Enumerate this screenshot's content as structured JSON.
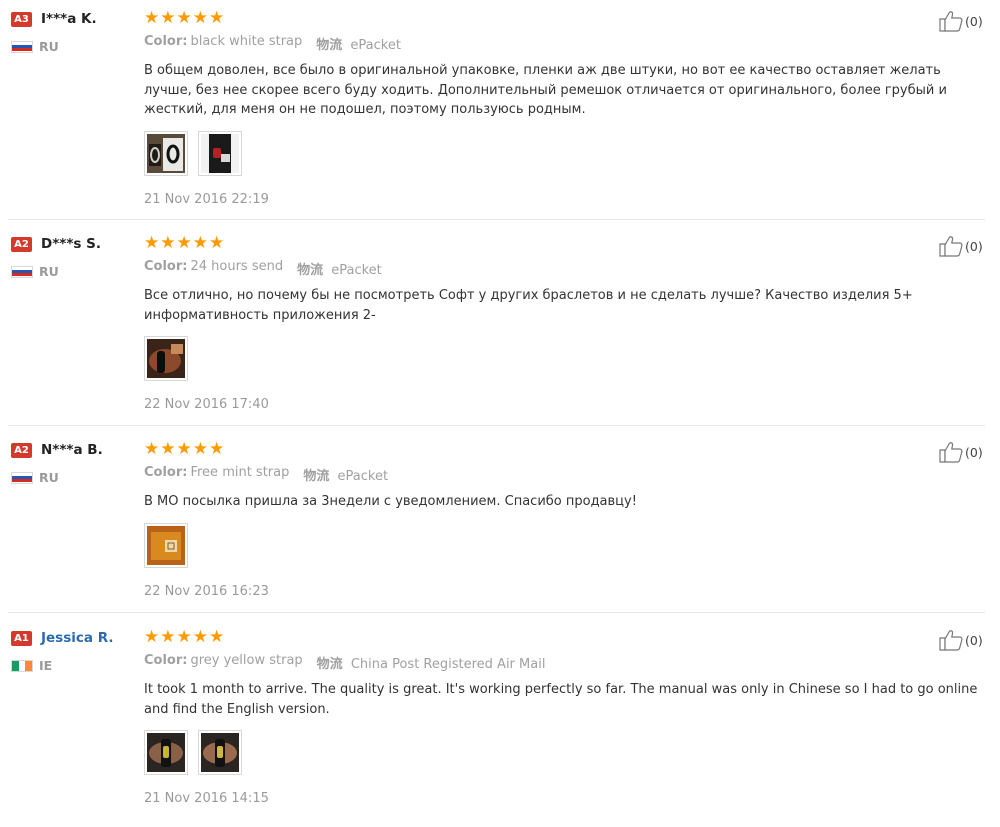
{
  "labels": {
    "color": "Color:",
    "shipping": "物流"
  },
  "reviews": [
    {
      "level": "A3",
      "name": "I***a K.",
      "country": "RU",
      "stars": 5,
      "color_value": "black white strap",
      "shipping_value": "ePacket",
      "text": "В общем доволен, все было в оригинальной упаковке, пленки аж две штуки, но вот ее качество оставляет желать лучше, без нее скорее всего буду ходить. Дополнительный ремешок отличается от оригинального, более грубый и жесткий, для меня он не подошел, поэтому пользуюсь родным.",
      "date": "21 Nov 2016 22:19",
      "likes": "(0)"
    },
    {
      "level": "A2",
      "name": "D***s S.",
      "country": "RU",
      "stars": 5,
      "color_value": "24 hours send",
      "shipping_value": "ePacket",
      "text": "Все отлично, но почему бы не посмотреть Софт у других браслетов и не сделать лучше? Качество изделия 5+ информативность приложения 2-",
      "date": "22 Nov 2016 17:40",
      "likes": "(0)"
    },
    {
      "level": "A2",
      "name": "N***a B.",
      "country": "RU",
      "stars": 5,
      "color_value": "Free mint strap",
      "shipping_value": "ePacket",
      "text": "В МО посылка пришла за 3недели с уведомлением. Спасибо продавцу!",
      "date": "22 Nov 2016 16:23",
      "likes": "(0)"
    },
    {
      "level": "A1",
      "name": "Jessica R.",
      "country": "IE",
      "stars": 5,
      "color_value": "grey yellow strap",
      "shipping_value": "China Post Registered Air Mail",
      "text": "It took 1 month to arrive. The quality is great. It's working perfectly so far. The manual was only in Chinese so I had to go online and find the English version.",
      "date": "21 Nov 2016 14:15",
      "likes": "(0)"
    }
  ],
  "colors": {
    "badge": "#d33a2c",
    "star": "#ff9b00",
    "muted": "#a0a0a0",
    "name_link": "#2b6cb0"
  }
}
